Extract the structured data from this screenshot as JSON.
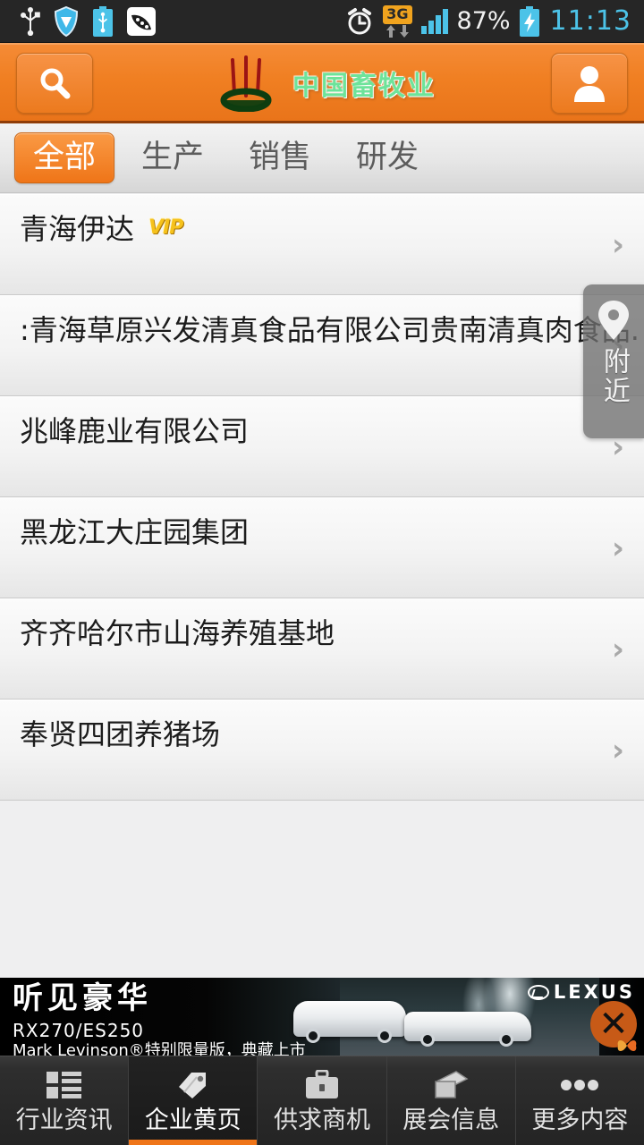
{
  "status_bar": {
    "icons_left": [
      "usb-icon",
      "shield-icon",
      "battery-usb-icon",
      "peapod-icon"
    ],
    "alarm_icon": "alarm-clock-icon",
    "network_type": "3G",
    "data_arrows_icon": "data-transfer-icon",
    "signal_icon": "signal-bars-icon",
    "battery_percent": "87%",
    "battery_icon": "battery-charging-icon",
    "time": "11:13"
  },
  "header": {
    "search_icon": "search-icon",
    "profile_icon": "user-profile-icon",
    "logo_icon": "incense-burner-logo",
    "title": "中国畜牧业"
  },
  "category_tabs": [
    {
      "label": "全部",
      "active": true
    },
    {
      "label": "生产",
      "active": false
    },
    {
      "label": "销售",
      "active": false
    },
    {
      "label": "研发",
      "active": false
    }
  ],
  "nearby_button": {
    "pin_icon": "location-pin-icon",
    "label": "附近"
  },
  "company_list": [
    {
      "name": "青海伊达",
      "vip": true,
      "vip_label": "VIP",
      "chevron": "›"
    },
    {
      "name": ":青海草原兴发清真食品有限公司贵南清真肉食品.",
      "vip": false,
      "chevron": "›"
    },
    {
      "name": "兆峰鹿业有限公司",
      "vip": false,
      "chevron": "›"
    },
    {
      "name": "黑龙江大庄园集团",
      "vip": false,
      "chevron": "›"
    },
    {
      "name": "齐齐哈尔市山海养殖基地",
      "vip": false,
      "chevron": "›"
    },
    {
      "name": "奉贤四团养猪场",
      "vip": false,
      "chevron": "›"
    }
  ],
  "ad_banner": {
    "headline": "听见豪华",
    "model": "RX270/ES250",
    "subtitle": "Mark Levinson®特别限量版，典藏上市",
    "brand": "LEXUS",
    "close_label": "✕",
    "close_color": "#c75a17"
  },
  "bottom_nav": [
    {
      "label": "行业资讯",
      "icon": "grid-list-icon",
      "active": false
    },
    {
      "label": "企业黄页",
      "icon": "tag-icon",
      "active": true
    },
    {
      "label": "供求商机",
      "icon": "briefcase-icon",
      "active": false
    },
    {
      "label": "展会信息",
      "icon": "photos-icon",
      "active": false
    },
    {
      "label": "更多内容",
      "icon": "more-dots-icon",
      "active": false
    }
  ],
  "colors": {
    "accent_orange": "#ef7519",
    "header_orange": "#f07f22",
    "logo_green": "#6ee39a",
    "status_cyan": "#4cc3e8",
    "network_badge": "#f0a31e"
  }
}
